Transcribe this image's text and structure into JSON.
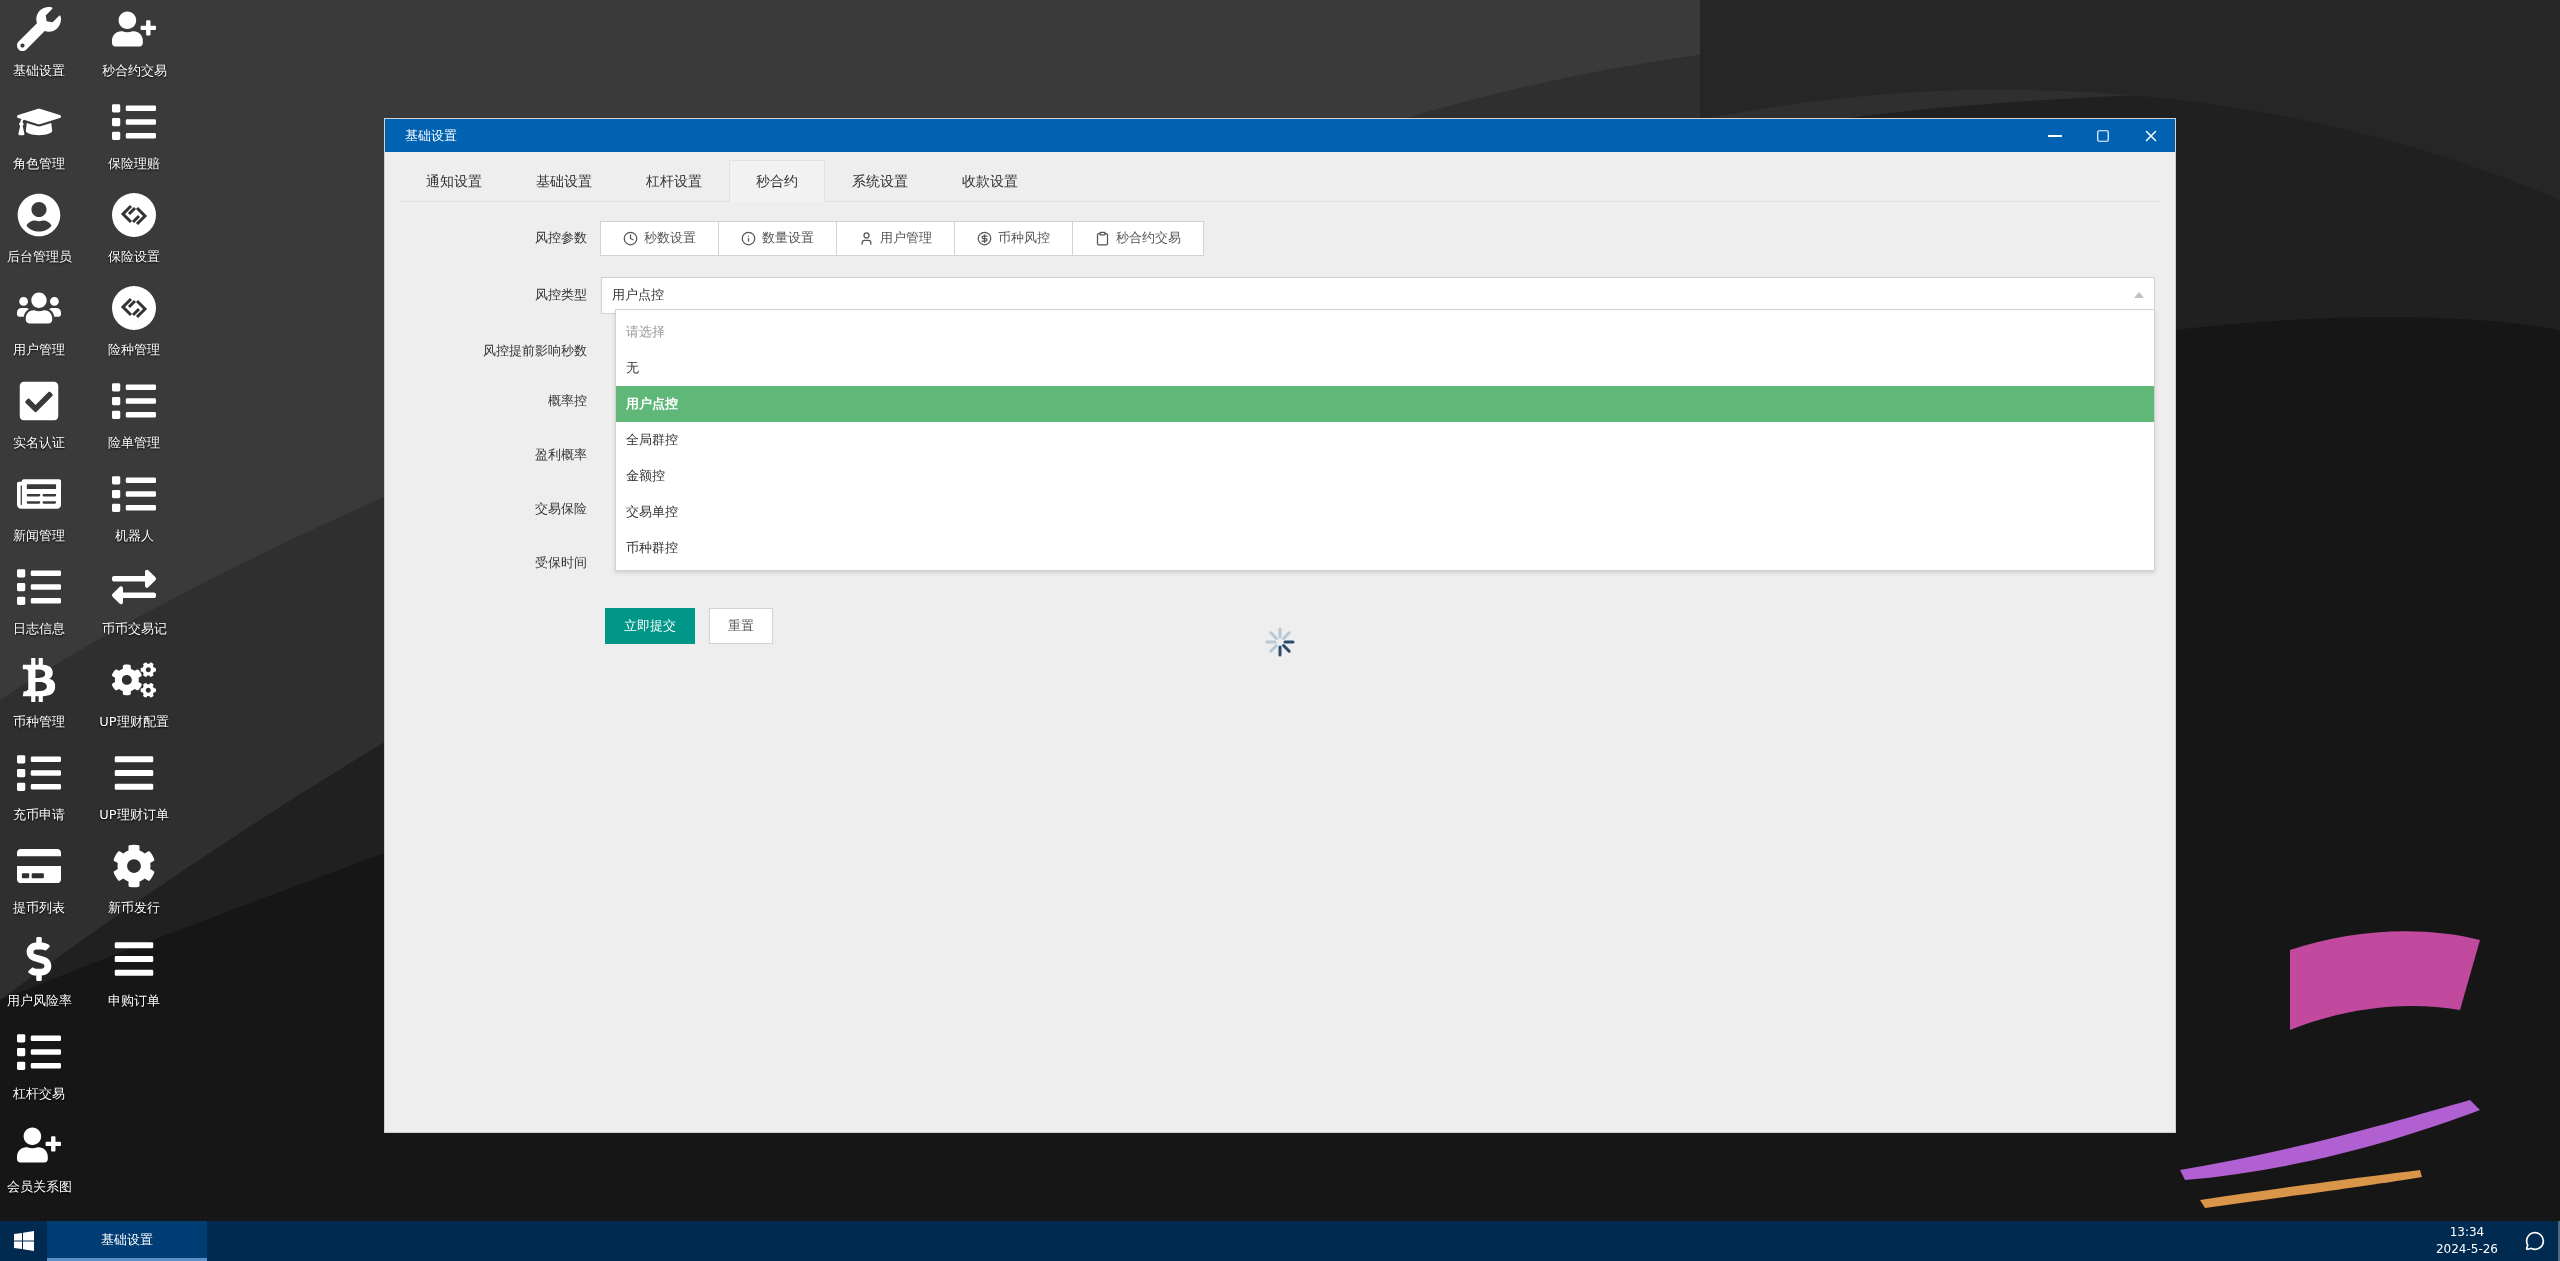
{
  "desktop_icons": [
    {
      "items": [
        {
          "label": "基础设置"
        },
        {
          "label": "角色管理"
        },
        {
          "label": "后台管理员"
        },
        {
          "label": "用户管理"
        },
        {
          "label": "实名认证"
        },
        {
          "label": "新闻管理"
        },
        {
          "label": "日志信息"
        },
        {
          "label": "币种管理"
        },
        {
          "label": "充币申请"
        },
        {
          "label": "提币列表"
        },
        {
          "label": "用户风险率"
        },
        {
          "label": "杠杆交易"
        },
        {
          "label": "会员关系图"
        }
      ]
    },
    {
      "items": [
        {
          "label": "秒合约交易"
        },
        {
          "label": "保险理赔"
        },
        {
          "label": "保险设置"
        },
        {
          "label": "险种管理"
        },
        {
          "label": "险单管理"
        },
        {
          "label": "机器人"
        },
        {
          "label": "币币交易记"
        },
        {
          "label": "UP理财配置"
        },
        {
          "label": "UP理财订单"
        },
        {
          "label": "新币发行"
        },
        {
          "label": "申购订单"
        }
      ]
    }
  ],
  "window": {
    "title": "基础设置",
    "tabs": [
      {
        "label": "通知设置",
        "selected": false
      },
      {
        "label": "基础设置",
        "selected": false
      },
      {
        "label": "杠杆设置",
        "selected": false
      },
      {
        "label": "秒合约",
        "selected": true
      },
      {
        "label": "系统设置",
        "selected": false
      },
      {
        "label": "收款设置",
        "selected": false
      }
    ],
    "form": {
      "params_label": "风控参数",
      "param_tabs": [
        {
          "label": "秒数设置"
        },
        {
          "label": "数量设置"
        },
        {
          "label": "用户管理"
        },
        {
          "label": "币种风控"
        },
        {
          "label": "秒合约交易"
        }
      ],
      "type_label": "风控类型",
      "type_select": {
        "value": "用户点控",
        "expanded": true,
        "placeholder": "请选择",
        "options": [
          {
            "label": "无",
            "selected": false
          },
          {
            "label": "用户点控",
            "selected": true
          },
          {
            "label": "全局群控",
            "selected": false
          },
          {
            "label": "金额控",
            "selected": false
          },
          {
            "label": "交易单控",
            "selected": false
          },
          {
            "label": "币种群控",
            "selected": false
          }
        ]
      },
      "other_labels": [
        "风控提前影响秒数",
        "概率控",
        "盈利概率",
        "交易保险",
        "受保时间"
      ],
      "buttons": [
        {
          "label": "立即提交",
          "kind": "primary"
        },
        {
          "label": "重置",
          "kind": "default"
        }
      ]
    }
  },
  "taskbar": {
    "tasks": [
      {
        "label": "基础设置",
        "selected": true
      }
    ],
    "time": "13:34",
    "date": "2024-5-26"
  }
}
